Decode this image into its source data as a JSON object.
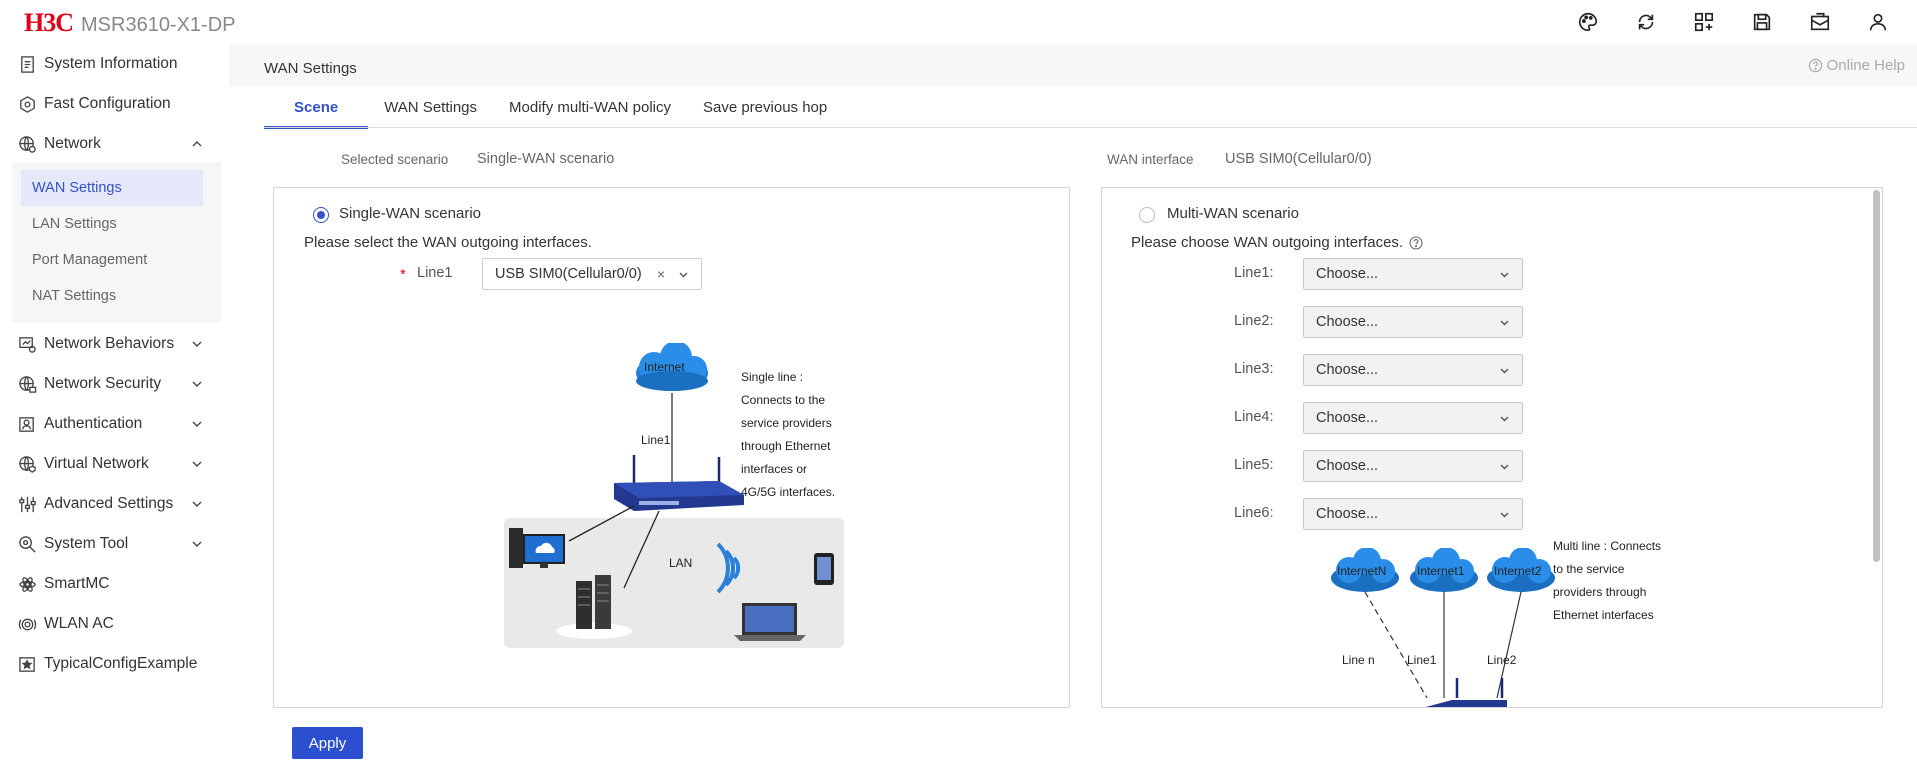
{
  "header": {
    "brand": "H3C",
    "model": "MSR3610-X1-DP",
    "icons": [
      "palette-icon",
      "sync-icon",
      "apps-icon",
      "save-icon",
      "mailbox-icon",
      "user-icon"
    ]
  },
  "sidebar": {
    "items": [
      {
        "label": "System Information",
        "icon": "document-icon"
      },
      {
        "label": "Fast Configuration",
        "icon": "hexagon-icon"
      },
      {
        "label": "Network",
        "icon": "globe-icon",
        "expanded": true
      },
      {
        "label": "Network Behaviors",
        "icon": "monitor-icon"
      },
      {
        "label": "Network Security",
        "icon": "globe-lock-icon"
      },
      {
        "label": "Authentication",
        "icon": "id-card-icon"
      },
      {
        "label": "Virtual Network",
        "icon": "globe-shield-icon"
      },
      {
        "label": "Advanced Settings",
        "icon": "sliders-icon"
      },
      {
        "label": "System Tool",
        "icon": "search-gear-icon"
      },
      {
        "label": "SmartMC",
        "icon": "atom-icon"
      },
      {
        "label": "WLAN AC",
        "icon": "wifi-ring-icon"
      },
      {
        "label": "TypicalConfigExample",
        "icon": "star-image-icon"
      }
    ],
    "network_sub": [
      "WAN Settings",
      "LAN Settings",
      "Port Management",
      "NAT Settings"
    ]
  },
  "page": {
    "title": "WAN Settings",
    "help": "Online Help"
  },
  "tabs": [
    "Scene",
    "WAN Settings",
    "Modify multi-WAN policy",
    "Save previous hop"
  ],
  "summary": {
    "scenario_label": "Selected scenario",
    "scenario_value": "Single-WAN scenario",
    "wan_label": "WAN interface",
    "wan_value": "USB SIM0(Cellular0/0)"
  },
  "single": {
    "radio_label": "Single-WAN scenario",
    "hint": "Please select the WAN outgoing interfaces.",
    "line_label": "Line1",
    "line_value": "USB SIM0(Cellular0/0)",
    "clear": "×",
    "diagram": {
      "internet": "Internet",
      "line": "Line1",
      "lan": "LAN",
      "desc": [
        "Single line :",
        "Connects to the",
        "service providers",
        "through Ethernet",
        "interfaces or",
        "4G/5G interfaces."
      ]
    }
  },
  "multi": {
    "radio_label": "Multi-WAN scenario",
    "hint": "Please choose WAN outgoing interfaces.",
    "lines": [
      {
        "label": "Line1:",
        "value": "Choose..."
      },
      {
        "label": "Line2:",
        "value": "Choose..."
      },
      {
        "label": "Line3:",
        "value": "Choose..."
      },
      {
        "label": "Line4:",
        "value": "Choose..."
      },
      {
        "label": "Line5:",
        "value": "Choose..."
      },
      {
        "label": "Line6:",
        "value": "Choose..."
      }
    ],
    "diagram": {
      "clouds": [
        "InternetN",
        "Internet1",
        "Internet2"
      ],
      "lines": [
        "Line n",
        "Line1",
        "Line2"
      ],
      "desc": [
        "Multi line : Connects",
        "to the service",
        "providers through",
        "Ethernet interfaces"
      ]
    }
  },
  "apply": "Apply",
  "colors": {
    "accent": "#3553c8",
    "brand": "#e0001b",
    "apply": "#2b4fcf"
  }
}
